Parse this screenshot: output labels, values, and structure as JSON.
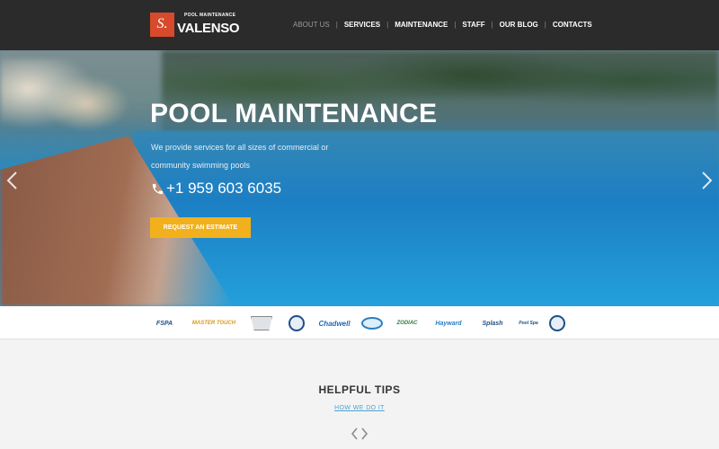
{
  "brand": {
    "logo_letter": "S.",
    "tagline": "POOL MAINTENANCE",
    "name": "VALENSO",
    "accent": "#d84a2b"
  },
  "nav": {
    "items": [
      {
        "label": "ABOUT US",
        "active": true
      },
      {
        "label": "SERVICES",
        "active": false
      },
      {
        "label": "MAINTENANCE",
        "active": false
      },
      {
        "label": "STAFF",
        "active": false
      },
      {
        "label": "OUR BLOG",
        "active": false
      },
      {
        "label": "CONTACTS",
        "active": false
      }
    ],
    "separator": "|"
  },
  "hero": {
    "title": "POOL MAINTENANCE",
    "description": "We provide services for all sizes of commercial or community swimming pools",
    "phone": "+1 959 603 6035",
    "cta_label": "REQUEST AN ESTIMATE",
    "cta_color": "#f2b11c",
    "prev_icon": "chevron-left-icon",
    "next_icon": "chevron-right-icon"
  },
  "partners": [
    {
      "label": "FSPA",
      "color": "#1d4f8a"
    },
    {
      "label": "MASTER TOUCH",
      "color": "#d89a1a"
    },
    {
      "label": "",
      "icon": "shield-badge"
    },
    {
      "label": "",
      "icon": "circle-badge"
    },
    {
      "label": "Chadwell",
      "color": "#1e6bc0"
    },
    {
      "label": "",
      "icon": "oval-badge"
    },
    {
      "label": "ZODIAC",
      "color": "#2a7a3a"
    },
    {
      "label": "Hayward",
      "color": "#2a7ec0"
    },
    {
      "label": "Splash",
      "color": "#1d4f8a"
    },
    {
      "label": "Pool Spa",
      "color": "#1d4f8a"
    },
    {
      "label": "",
      "icon": "circle-badge"
    }
  ],
  "tips": {
    "title": "HELPFUL TIPS",
    "link": "HOW WE DO IT",
    "prev_icon": "chevron-left-icon",
    "next_icon": "chevron-right-icon"
  }
}
